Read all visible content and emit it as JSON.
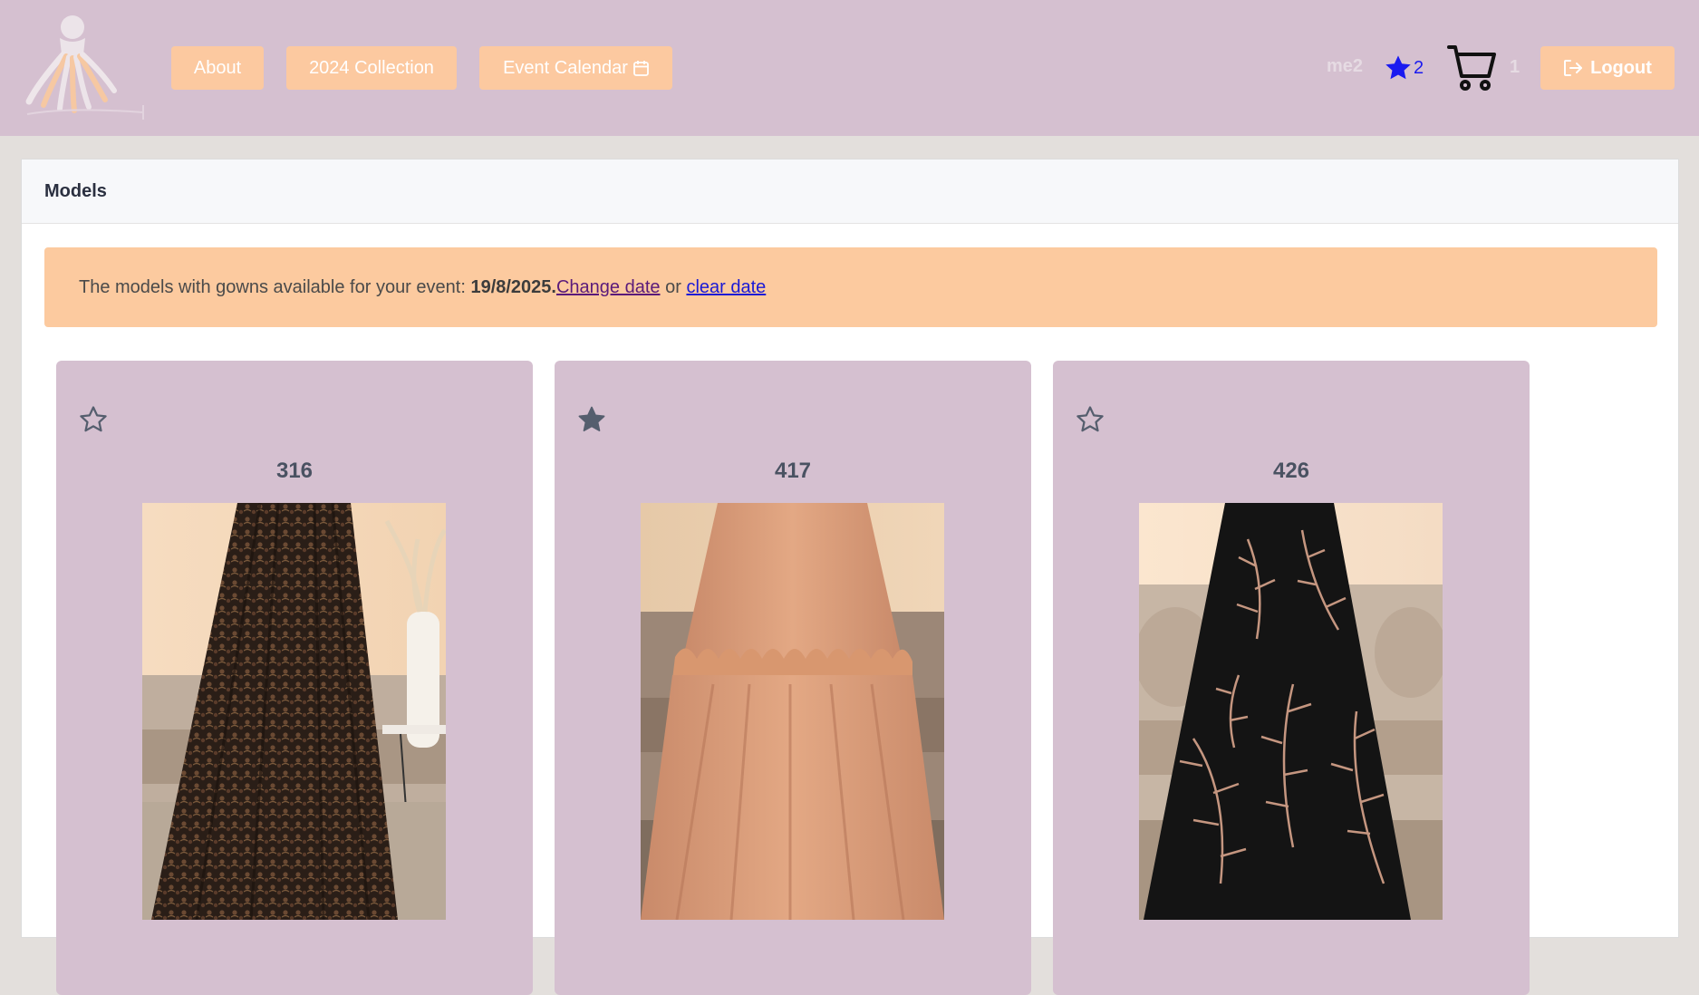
{
  "nav": {
    "about": "About",
    "collection": "2024 Collection",
    "calendar": "Event Calendar",
    "username": "me2",
    "favorites_count": "2",
    "cart_count": "1",
    "logout": "Logout"
  },
  "main": {
    "title": "Models",
    "alert": {
      "text": "The models with gowns available for your event: ",
      "date": "19/8/2025.",
      "change_link": "Change date",
      "or": " or ",
      "clear_link": "clear date"
    },
    "models": [
      {
        "number": "316",
        "favorited": false
      },
      {
        "number": "417",
        "favorited": true
      },
      {
        "number": "426",
        "favorited": false
      }
    ]
  },
  "colors": {
    "header": "#d5c0d0",
    "accent": "#fcc9a0",
    "alert": "#fcca9f",
    "card": "#d5c0d0",
    "favorite_star": "#1a1af0",
    "text_dark": "#4a5262"
  },
  "icons": [
    "calendar-icon",
    "star-icon",
    "cart-icon",
    "logout-icon",
    "star-outline-icon",
    "star-filled-icon"
  ]
}
